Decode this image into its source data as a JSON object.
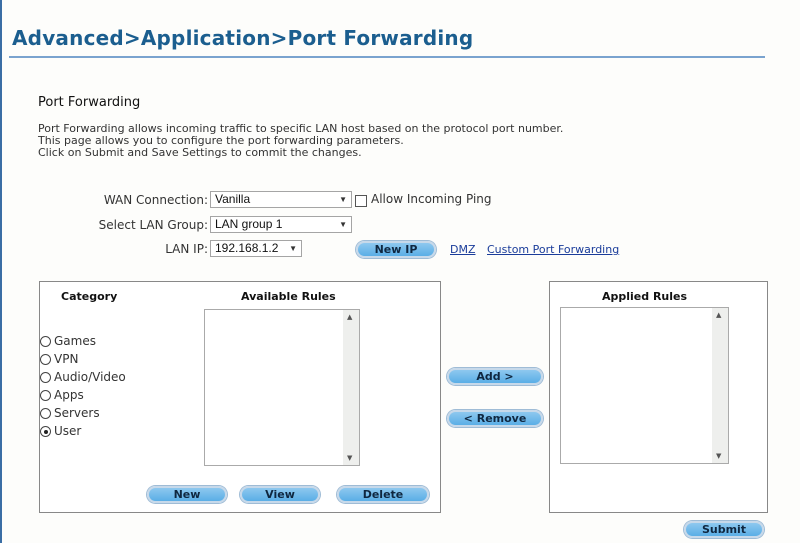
{
  "page": {
    "title": "Advanced>Application>Port Forwarding",
    "section_title": "Port Forwarding",
    "description": [
      "Port Forwarding allows incoming traffic to specific LAN host based on the protocol port number.",
      "This page allows you to configure the port forwarding parameters.",
      "Click on Submit and Save Settings to commit the changes."
    ]
  },
  "form": {
    "wan_connection": {
      "label": "WAN Connection:",
      "value": "Vanilla"
    },
    "allow_ping": {
      "label": "Allow Incoming Ping",
      "checked": false
    },
    "lan_group": {
      "label": "Select LAN Group:",
      "value": "LAN group 1"
    },
    "lan_ip": {
      "label": "LAN IP:",
      "value": "192.168.1.2"
    },
    "new_ip_label": "New IP",
    "links": {
      "dmz": "DMZ",
      "custom": "Custom Port Forwarding"
    }
  },
  "rules_panel": {
    "category_header": "Category",
    "available_header": "Available Rules",
    "categories": [
      {
        "label": "Games",
        "selected": false
      },
      {
        "label": "VPN",
        "selected": false
      },
      {
        "label": "Audio/Video",
        "selected": false
      },
      {
        "label": "Apps",
        "selected": false
      },
      {
        "label": "Servers",
        "selected": false
      },
      {
        "label": "User",
        "selected": true
      }
    ],
    "available_rules": [],
    "buttons": {
      "new": "New",
      "view": "View",
      "delete": "Delete"
    }
  },
  "transfer": {
    "add": "Add >",
    "remove": "< Remove"
  },
  "applied_panel": {
    "header": "Applied Rules",
    "applied_rules": []
  },
  "submit_label": "Submit",
  "icons": {
    "dropdown": "▼",
    "scroll_up": "▲",
    "scroll_down": "▼"
  }
}
